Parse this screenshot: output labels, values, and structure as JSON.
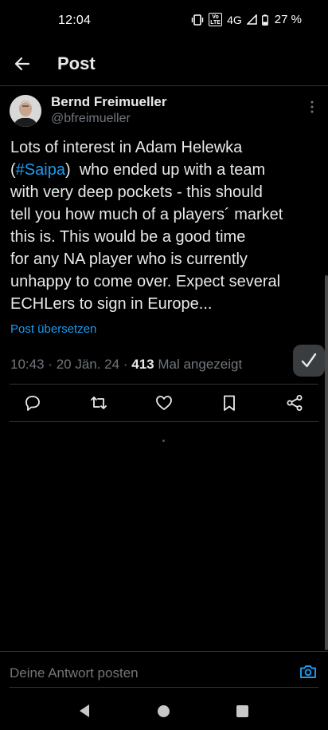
{
  "status_bar": {
    "time": "12:04",
    "volte": "Vo LTE",
    "network": "4G",
    "battery_percent": "27 %"
  },
  "header": {
    "title": "Post"
  },
  "tweet": {
    "author_name": "Bernd Freimueller",
    "author_handle": "@bfreimueller",
    "text_lines": [
      "Lots of interest in Adam Helewka",
      "(",
      "#Saipa",
      ")  who ended up with a team",
      "with very deep pockets - this should",
      "tell you how much of a players´ market",
      "this is. This would be a good time",
      "for any NA player who is currently",
      "unhappy to come over. Expect several",
      "ECHLers to sign in Europe..."
    ],
    "translate_label": "Post übersetzen",
    "time": "10:43",
    "date": "20 Jän. 24",
    "views_count": "413",
    "views_label": "Mal angezeigt",
    "separator": "·"
  },
  "actions": {
    "icons": [
      "reply-icon",
      "repost-icon",
      "like-icon",
      "bookmark-icon",
      "share-icon"
    ]
  },
  "reply": {
    "placeholder": "Deine Antwort posten"
  },
  "colors": {
    "background": "#000000",
    "text": "#e7e9ea",
    "secondary": "#71767b",
    "accent": "#1d9bf0",
    "divider": "#2f3336"
  }
}
